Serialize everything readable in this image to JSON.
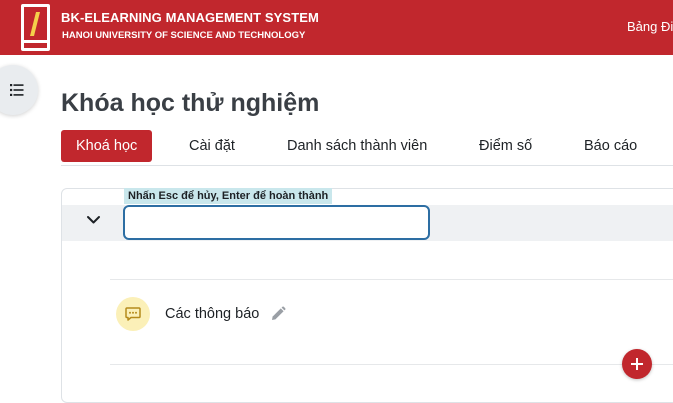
{
  "header": {
    "brand_title": "BK-ELEARNING MANAGEMENT SYSTEM",
    "brand_subtitle": "HANOI UNIVERSITY OF SCIENCE AND TECHNOLOGY",
    "nav_link": "Bảng Đi",
    "logo_icon": "bk-logo",
    "accent_color": "#c1272d"
  },
  "drawer": {
    "icon": "list-icon"
  },
  "page": {
    "title": "Khóa học thử nghiệm"
  },
  "tabs": [
    {
      "label": "Khoá học",
      "active": true
    },
    {
      "label": "Cài đặt",
      "active": false
    },
    {
      "label": "Danh sách thành viên",
      "active": false
    },
    {
      "label": "Điểm số",
      "active": false
    },
    {
      "label": "Báo cáo",
      "active": false
    }
  ],
  "section": {
    "collapse_icon": "chevron-down-icon",
    "edit_hint": "Nhấn Esc để hủy, Enter để hoàn thành",
    "name_value": "",
    "activities": [
      {
        "name": "Các thông báo",
        "icon": "forum-icon",
        "edit_icon": "pencil-icon"
      }
    ],
    "add_icon": "plus-icon"
  }
}
